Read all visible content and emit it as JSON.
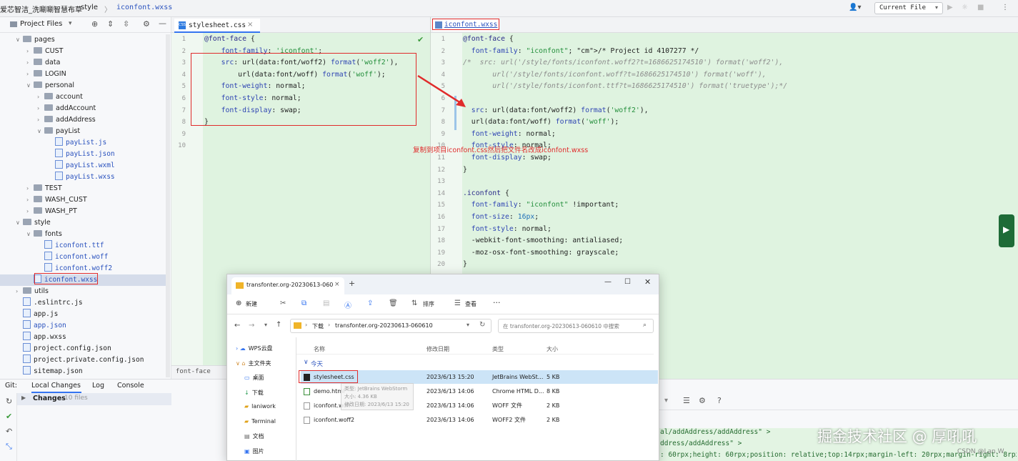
{
  "topbar": {
    "breadcrumb_project": "爱芯智洁_洗唰唰智慧布草",
    "breadcrumb_folder": "style",
    "breadcrumb_file": "iconfont.wxss",
    "current_file": "Current File"
  },
  "project": {
    "header": "Project Files",
    "items": [
      {
        "label": "pages",
        "type": "folder",
        "depth": 0,
        "open": true
      },
      {
        "label": "CUST",
        "type": "folder",
        "depth": 1
      },
      {
        "label": "data",
        "type": "folder",
        "depth": 1
      },
      {
        "label": "LOGIN",
        "type": "folder",
        "depth": 1
      },
      {
        "label": "personal",
        "type": "folder",
        "depth": 1,
        "open": true
      },
      {
        "label": "account",
        "type": "folder",
        "depth": 2
      },
      {
        "label": "addAccount",
        "type": "folder",
        "depth": 2
      },
      {
        "label": "addAddress",
        "type": "folder",
        "depth": 2
      },
      {
        "label": "payList",
        "type": "folder",
        "depth": 2,
        "open": true
      },
      {
        "label": "payList.js",
        "type": "file",
        "depth": 3,
        "blue": true
      },
      {
        "label": "payList.json",
        "type": "file",
        "depth": 3,
        "blue": true
      },
      {
        "label": "payList.wxml",
        "type": "file",
        "depth": 3,
        "blue": true
      },
      {
        "label": "payList.wxss",
        "type": "file",
        "depth": 3,
        "blue": true
      },
      {
        "label": "TEST",
        "type": "folder",
        "depth": 1
      },
      {
        "label": "WASH_CUST",
        "type": "folder",
        "depth": 1
      },
      {
        "label": "WASH_PT",
        "type": "folder",
        "depth": 1
      },
      {
        "label": "style",
        "type": "folder",
        "depth": 0,
        "open": true
      },
      {
        "label": "fonts",
        "type": "folder",
        "depth": 1,
        "open": true
      },
      {
        "label": "iconfont.ttf",
        "type": "file",
        "depth": 2,
        "blue": true
      },
      {
        "label": "iconfont.woff",
        "type": "file",
        "depth": 2,
        "blue": true
      },
      {
        "label": "iconfont.woff2",
        "type": "file",
        "depth": 2,
        "blue": true
      },
      {
        "label": "iconfont.wxss",
        "type": "file",
        "depth": 1,
        "blue": true,
        "selected": true
      },
      {
        "label": "utils",
        "type": "folder",
        "depth": 0
      },
      {
        "label": ".eslintrc.js",
        "type": "file",
        "depth": 0
      },
      {
        "label": "app.js",
        "type": "file",
        "depth": 0
      },
      {
        "label": "app.json",
        "type": "file",
        "depth": 0,
        "blue": true
      },
      {
        "label": "app.wxss",
        "type": "file",
        "depth": 0
      },
      {
        "label": "project.config.json",
        "type": "file",
        "depth": 0
      },
      {
        "label": "project.private.config.json",
        "type": "file",
        "depth": 0
      },
      {
        "label": "sitemap.json",
        "type": "file",
        "depth": 0
      }
    ]
  },
  "editor_left": {
    "tab": "stylesheet.css",
    "breadcrumb": "font-face",
    "lines": [
      "@font-face {",
      "    font-family: 'iconfont';",
      "    src: url(data:font/woff2) format('woff2'),",
      "        url(data:font/woff) format('woff');",
      "    font-weight: normal;",
      "    font-style: normal;",
      "    font-display: swap;",
      "}",
      "",
      ""
    ]
  },
  "editor_right": {
    "tab": "iconfont.wxss",
    "lines": [
      "@font-face {",
      "  font-family: \"iconfont\"; /* Project id 4107277 */",
      "/*  src: url('/style/fonts/iconfont.woff2?t=1686625174510') format('woff2'),",
      "       url('/style/fonts/iconfont.woff?t=1686625174510') format('woff'),",
      "       url('/style/fonts/iconfont.ttf?t=1686625174510') format('truetype');*/",
      "",
      "  src: url(data:font/woff2) format('woff2'),",
      "  url(data:font/woff) format('woff');",
      "  font-weight: normal;",
      "  font-style: normal;",
      "  font-display: swap;",
      "}",
      "",
      ".iconfont {",
      "  font-family: \"iconfont\" !important;",
      "  font-size: 16px;",
      "  font-style: normal;",
      "  -webkit-font-smoothing: antialiased;",
      "  -moz-osx-font-smoothing: grayscale;",
      "}"
    ],
    "annotation": "复制到项目iconfont.css然后把文件名改成iconfont.wxss"
  },
  "bottom": {
    "tabs": [
      "Git:",
      "Local Changes",
      "Log",
      "Console"
    ],
    "changes_label": "Changes",
    "changes_count": "10 files",
    "log_lines": [
      "al/addAddress/addAddress\" >",
      "ddress/addAddress\" >",
      ": 60rpx;height: 60rpx;position: relative;top:14rpx;margin-left: 20rpx;margin-right: 8rpx"
    ],
    "watermark": "掘金技术社区 @ 厚吼吼",
    "csdn": "CSDN @Lan.W"
  },
  "explorer": {
    "title": "transfonter.org-20230613-060",
    "toolbar": {
      "new": "新建",
      "sort": "排序",
      "view": "查看"
    },
    "path": [
      "下载",
      "transfonter.org-20230613-060610"
    ],
    "search_placeholder": "在 transfonter.org-20230613-060610 中搜索",
    "columns": [
      "名称",
      "修改日期",
      "类型",
      "大小"
    ],
    "group": "今天",
    "files": [
      {
        "name": "stylesheet.css",
        "date": "2023/6/13 15:20",
        "type": "JetBrains WebSt...",
        "size": "5 KB"
      },
      {
        "name": "demo.html",
        "date": "2023/6/13 14:06",
        "type": "Chrome HTML D...",
        "size": "8 KB"
      },
      {
        "name": "iconfont.woff",
        "date": "2023/6/13 14:06",
        "type": "WOFF 文件",
        "size": "2 KB"
      },
      {
        "name": "iconfont.woff2",
        "date": "2023/6/13 14:06",
        "type": "WOFF2 文件",
        "size": "2 KB"
      }
    ],
    "tooltip": [
      "类型: JetBrains WebStorm",
      "大小: 4.36 KB",
      "修改日期: 2023/6/13 15:20"
    ],
    "sidebar": [
      "WPS云盘",
      "主文件夹",
      "桌面",
      "下载",
      "laniwork",
      "Terminal",
      "文档",
      "图片"
    ]
  }
}
